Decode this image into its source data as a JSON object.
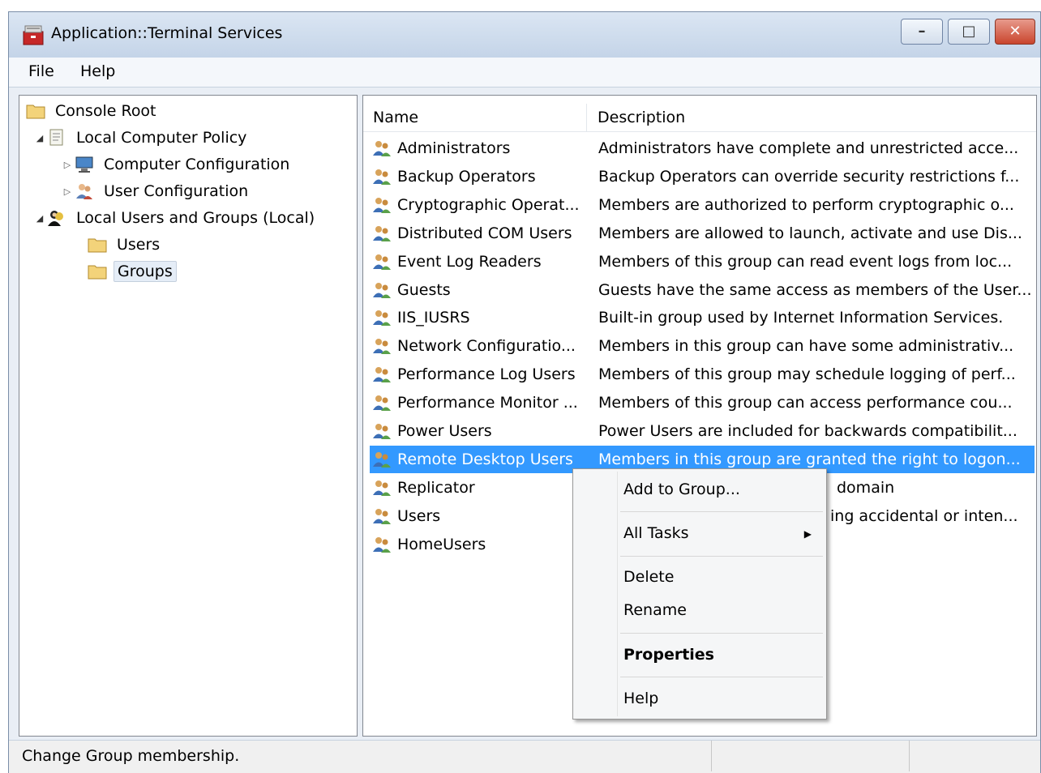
{
  "window": {
    "title": "Application::Terminal Services"
  },
  "caption_buttons": {
    "minimize": "–",
    "maximize": "□",
    "close": "✕"
  },
  "menubar": {
    "items": [
      "File",
      "Help"
    ]
  },
  "tree": {
    "items": [
      {
        "label": "Console Root",
        "icon": "folder-icon"
      },
      {
        "label": "Local Computer Policy",
        "icon": "policy-icon"
      },
      {
        "label": "Computer Configuration",
        "icon": "computer-icon"
      },
      {
        "label": "User Configuration",
        "icon": "users-icon"
      },
      {
        "label": "Local Users and Groups (Local)",
        "icon": "users-groups-icon"
      },
      {
        "label": "Users",
        "icon": "folder-icon"
      },
      {
        "label": "Groups",
        "icon": "folder-icon",
        "selected": true
      }
    ]
  },
  "list": {
    "columns": [
      "Name",
      "Description"
    ],
    "rows": [
      {
        "name": "Administrators",
        "description": "Administrators have complete and unrestricted acce..."
      },
      {
        "name": "Backup Operators",
        "description": "Backup Operators can override security restrictions f..."
      },
      {
        "name": "Cryptographic Operat...",
        "description": "Members are authorized to perform cryptographic o..."
      },
      {
        "name": "Distributed COM Users",
        "description": "Members are allowed to launch, activate and use Dis..."
      },
      {
        "name": "Event Log Readers",
        "description": "Members of this group can read event logs from loc..."
      },
      {
        "name": "Guests",
        "description": "Guests have the same access as members of the User..."
      },
      {
        "name": "IIS_IUSRS",
        "description": "Built-in group used by Internet Information Services."
      },
      {
        "name": "Network Configuratio...",
        "description": "Members in this group can have some administrativ..."
      },
      {
        "name": "Performance Log Users",
        "description": "Members of this group may schedule logging of perf..."
      },
      {
        "name": "Performance Monitor ...",
        "description": "Members of this group can access performance cou..."
      },
      {
        "name": "Power Users",
        "description": "Power Users are included for backwards compatibilit..."
      },
      {
        "name": "Remote Desktop Users",
        "description": "Members in this group are granted the right to logon...",
        "selected": true
      },
      {
        "name": "Replicator",
        "description": "domain"
      },
      {
        "name": "Users",
        "description": "ing accidental or inten..."
      },
      {
        "name": "HomeUsers",
        "description": ""
      }
    ]
  },
  "context_menu": {
    "items": [
      "Add to Group...",
      "All Tasks",
      "Delete",
      "Rename",
      "Properties",
      "Help"
    ],
    "submenu_arrow": "▶"
  },
  "statusbar": {
    "text": "Change Group membership."
  },
  "colors": {
    "selection": "#3399ff",
    "titlebar": "#c4d4e8",
    "close_button": "#c9452d"
  }
}
